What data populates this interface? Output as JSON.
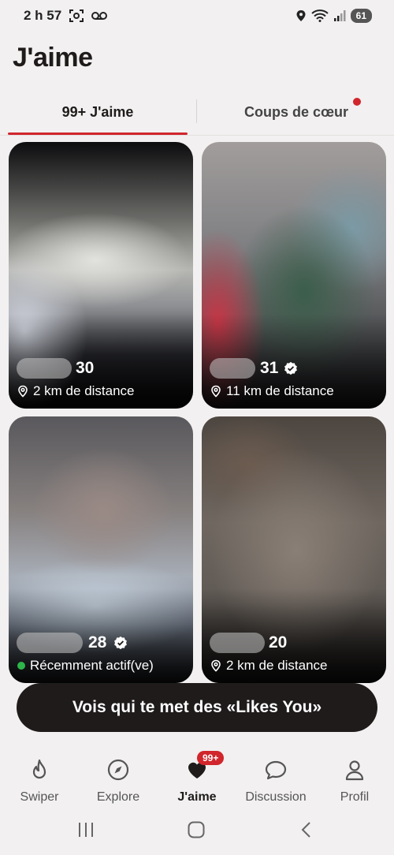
{
  "status_bar": {
    "time": "2 h 57",
    "battery": "61"
  },
  "page": {
    "title": "J'aime"
  },
  "tabs": [
    {
      "label": "99+ J'aime",
      "active": true
    },
    {
      "label": "Coups de cœur",
      "active": false,
      "has_notification": true
    }
  ],
  "cards": [
    {
      "age": "30",
      "verified": false,
      "info_type": "distance",
      "info": "2 km de distance"
    },
    {
      "age": "31",
      "verified": true,
      "info_type": "distance",
      "info": "11 km de distance"
    },
    {
      "age": "28",
      "verified": true,
      "info_type": "active",
      "info": "Récemment actif(ve)"
    },
    {
      "age": "20",
      "verified": false,
      "info_type": "distance",
      "info": "2 km de distance"
    }
  ],
  "cta": {
    "label": "Vois qui te met des «Likes You»"
  },
  "bottom_nav": [
    {
      "label": "Swiper",
      "icon": "flame-icon",
      "active": false
    },
    {
      "label": "Explore",
      "icon": "compass-icon",
      "active": false
    },
    {
      "label": "J'aime",
      "icon": "heart-icon",
      "active": true,
      "badge": "99+"
    },
    {
      "label": "Discussion",
      "icon": "chat-bubble-icon",
      "active": false
    },
    {
      "label": "Profil",
      "icon": "person-icon",
      "active": false
    }
  ],
  "colors": {
    "accent": "#d0262c",
    "background": "#f2f0f0",
    "dark": "#1f1b1b",
    "online": "#2db54a"
  }
}
